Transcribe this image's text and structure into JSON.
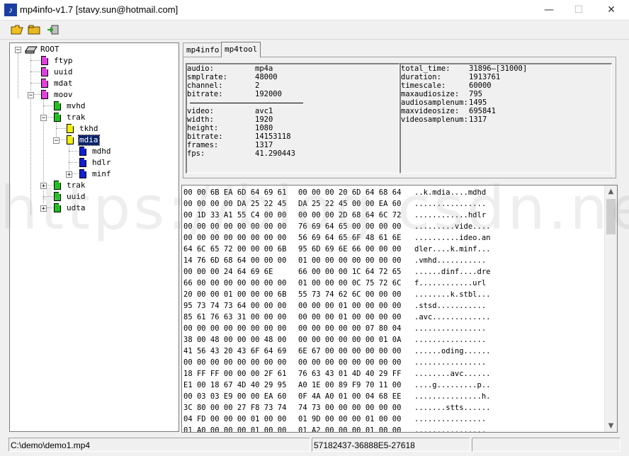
{
  "window": {
    "title": "mp4info-v1.7 [stavy.sun@hotmail.com]",
    "minimize": "—",
    "maximize": "☐",
    "close": "✕"
  },
  "toolbar": {
    "buttons": [
      "open-file-icon",
      "open-folder-icon",
      "exit-icon"
    ]
  },
  "tree": {
    "nodes": [
      {
        "label": "ROOT",
        "color": "#808080"
      },
      {
        "label": "ftyp",
        "color": "#e040e0"
      },
      {
        "label": "uuid",
        "color": "#e040e0"
      },
      {
        "label": "mdat",
        "color": "#e040e0"
      },
      {
        "label": "moov",
        "color": "#e040e0"
      },
      {
        "label": "mvhd",
        "color": "#20c020"
      },
      {
        "label": "trak",
        "color": "#20c020"
      },
      {
        "label": "tkhd",
        "color": "#f0f000"
      },
      {
        "label": "mdia",
        "color": "#f0f000",
        "selected": true
      },
      {
        "label": "mdhd",
        "color": "#1020d0"
      },
      {
        "label": "hdlr",
        "color": "#1020d0"
      },
      {
        "label": "minf",
        "color": "#1020d0"
      },
      {
        "label": "trak",
        "color": "#20c020"
      },
      {
        "label": "uuid",
        "color": "#20c020"
      },
      {
        "label": "udta",
        "color": "#20c020"
      }
    ]
  },
  "tabs": [
    {
      "label": "mp4info",
      "active": false
    },
    {
      "label": "mp4tool",
      "active": true
    }
  ],
  "info_left": {
    "audio": [
      {
        "key": "audio:",
        "value": "mp4a"
      },
      {
        "key": "smplrate:",
        "value": "48000"
      },
      {
        "key": "channel:",
        "value": "2"
      },
      {
        "key": "bitrate:",
        "value": "192000"
      }
    ],
    "video": [
      {
        "key": "video:",
        "value": "avc1"
      },
      {
        "key": "width:",
        "value": "1920"
      },
      {
        "key": "height:",
        "value": "1080"
      },
      {
        "key": "bitrate:",
        "value": "14153118"
      },
      {
        "key": "frames:",
        "value": "1317"
      },
      {
        "key": "fps:",
        "value": "41.290443"
      }
    ]
  },
  "info_right": [
    {
      "key": "total_time:",
      "value": "31896—[31000]"
    },
    {
      "key": "duration:",
      "value": "1913761"
    },
    {
      "key": "timescale:",
      "value": "60000"
    },
    {
      "key": "maxaudiosize:",
      "value": "795"
    },
    {
      "key": "audiosamplenum:",
      "value": "1495"
    },
    {
      "key": "maxvideosize:",
      "value": "695841"
    },
    {
      "key": "videosamplenum:",
      "value": "1317"
    }
  ],
  "hex_rows": [
    {
      "h1": "00 00 6B EA 6D 64 69 61",
      "h2": "00 00 00 20 6D 64 68 64",
      "asc": "..k.mdia....mdhd"
    },
    {
      "h1": "00 00 00 00 DA 25 22 45",
      "h2": "DA 25 22 45 00 00 EA 60",
      "asc": "................"
    },
    {
      "h1": "00 1D 33 A1 55 C4 00 00",
      "h2": "00 00 00 2D 68 64 6C 72",
      "asc": "............hdlr"
    },
    {
      "h1": "00 00 00 00 00 00 00 00",
      "h2": "76 69 64 65 00 00 00 00",
      "asc": ".........vide...."
    },
    {
      "h1": "00 00 00 00 00 00 00 00",
      "h2": "56 69 64 65 6F 48 61 6E",
      "asc": "..........ideo.an"
    },
    {
      "h1": "64 6C 65 72 00 00 00 6B",
      "h2": "95 6D 69 6E 66 00 00 00",
      "asc": "dler....k.minf..."
    },
    {
      "h1": "14 76 6D 68 64 00 00 00",
      "h2": "01 00 00 00 00 00 00 00",
      "asc": ".vmhd..........."
    },
    {
      "h1": "00 00 00 24 64 69 6E",
      "h2": "66 00 00 00 1C 64 72 65",
      "asc": "......dinf....dre"
    },
    {
      "h1": "66 00 00 00 00 00 00 00",
      "h2": "01 00 00 00 0C 75 72 6C",
      "asc": "f............url"
    },
    {
      "h1": "20 00 00 01 00 00 00 6B",
      "h2": "55 73 74 62 6C 00 00 00",
      "asc": "........k.stbl..."
    },
    {
      "h1": "95 73 74 73 64 00 00 00",
      "h2": "00 00 00 01 00 00 00 00",
      "asc": ".stsd..........."
    },
    {
      "h1": "85 61 76 63 31 00 00 00",
      "h2": "00 00 00 01 00 00 00 00",
      "asc": ".avc............."
    },
    {
      "h1": "00 00 00 00 00 00 00 00",
      "h2": "00 00 00 00 00 07 80 04",
      "asc": "................"
    },
    {
      "h1": "38 00 48 00 00 00 48 00",
      "h2": "00 00 00 00 00 00 01 0A",
      "asc": "................"
    },
    {
      "h1": "41 56 43 20 43 6F 64 69",
      "h2": "6E 67 00 00 00 00 00 00",
      "asc": "......oding......"
    },
    {
      "h1": "00 00 00 00 00 00 00 00",
      "h2": "00 00 00 00 00 00 00 00",
      "asc": "................"
    },
    {
      "h1": "18 FF FF 00 00 00 2F 61",
      "h2": "76 63 43 01 4D 40 29 FF",
      "asc": "........avc......"
    },
    {
      "h1": "E1 00 18 67 4D 40 29 95",
      "h2": "A0 1E 00 89 F9 70 11 00",
      "asc": "....g.........p.."
    },
    {
      "h1": "00 03 03 E9 00 00 EA 60",
      "h2": "0F 4A A0 01 00 04 68 EE",
      "asc": "...............h."
    },
    {
      "h1": "3C 80 00 00 27 F8 73 74",
      "h2": "74 73 00 00 00 00 00 00",
      "asc": ".......stts......"
    },
    {
      "h1": "04 FD 00 00 00 01 00 00",
      "h2": "01 9D 00 00 00 01 00 00",
      "asc": "................"
    },
    {
      "h1": "01 A0 00 00 00 01 00 00",
      "h2": "01 A2 00 00 00 01 00 00",
      "asc": "................"
    }
  ],
  "watermark": "https://blog.csdn.net",
  "status": {
    "file": "C:\\demo\\demo1.mp4",
    "info": "57182437-36888E5-27618",
    "extra": ""
  }
}
